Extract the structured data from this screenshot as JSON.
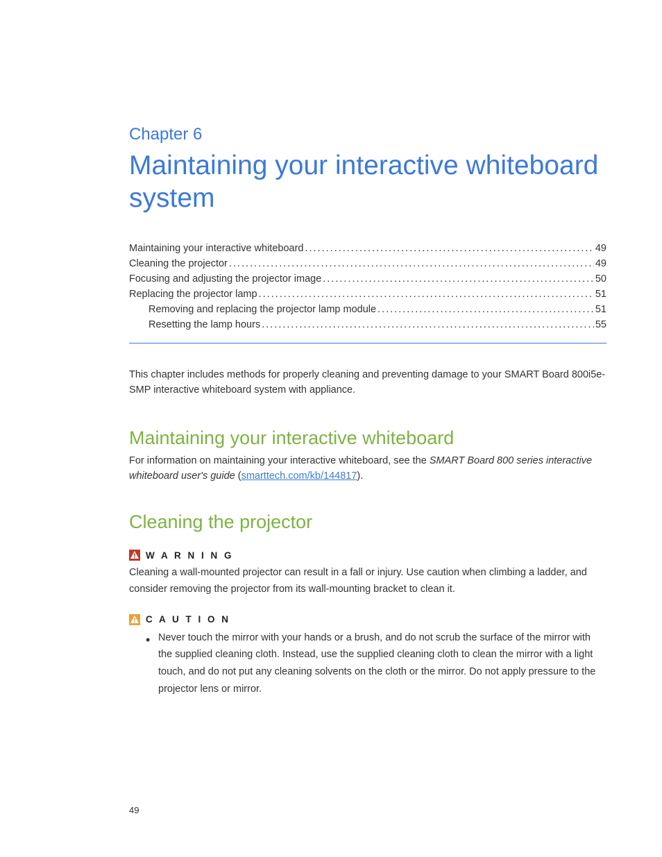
{
  "chapter": {
    "label": "Chapter 6",
    "title": "Maintaining your interactive whiteboard system"
  },
  "toc": [
    {
      "label": "Maintaining your interactive whiteboard",
      "page": "49",
      "indent": false
    },
    {
      "label": "Cleaning the projector",
      "page": "49",
      "indent": false
    },
    {
      "label": "Focusing and adjusting the projector image",
      "page": "50",
      "indent": false
    },
    {
      "label": "Replacing the projector lamp",
      "page": "51",
      "indent": false
    },
    {
      "label": "Removing and replacing the projector lamp module",
      "page": "51",
      "indent": true
    },
    {
      "label": "Resetting the lamp hours",
      "page": "55",
      "indent": true
    }
  ],
  "intro": "This chapter includes methods for properly cleaning and preventing damage to your SMART Board 800i5e-SMP interactive whiteboard system with appliance.",
  "section1": {
    "heading": "Maintaining your interactive whiteboard",
    "text_before": "For information on maintaining your interactive whiteboard, see the ",
    "italic_text": "SMART Board 800 series interactive whiteboard user's guide",
    "text_mid": " (",
    "link_text": "smarttech.com/kb/144817",
    "text_after": ")."
  },
  "section2": {
    "heading": "Cleaning the projector",
    "warning": {
      "label": "W A R N I N G",
      "text": "Cleaning a wall-mounted projector can result in a fall or injury. Use caution when climbing a ladder, and consider removing the projector from its wall-mounting bracket to clean it."
    },
    "caution": {
      "label": "C A U T I O N",
      "bullets": [
        "Never touch the mirror with your hands or a brush, and do not scrub the surface of the mirror with the supplied cleaning cloth. Instead, use the supplied cleaning cloth to clean the mirror with a light touch, and do not put any cleaning solvents on the cloth or the mirror. Do not apply pressure to the projector lens or mirror."
      ]
    }
  },
  "page_number": "49"
}
